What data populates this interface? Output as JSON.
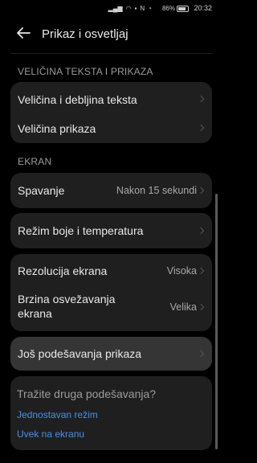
{
  "status_bar": {
    "battery_percent": "86%",
    "time": "20:32",
    "icons": [
      "signal-icon",
      "signal-icon",
      "wifi-icon",
      "notification-icon",
      "whatsapp-icon",
      "messenger-icon",
      "nfc-icon",
      "no-sound-icon",
      "alarm-icon"
    ]
  },
  "header": {
    "title": "Prikaz i osvetljaj"
  },
  "sections": {
    "text_display": {
      "label": "VELIČINA TEKSTA I PRIKAZA",
      "items": [
        {
          "label": "Veličina i debljina teksta"
        },
        {
          "label": "Veličina prikaza"
        }
      ]
    },
    "screen": {
      "label": "EKRAN",
      "sleep": {
        "label": "Spavanje",
        "value": "Nakon 15 sekundi"
      },
      "color": {
        "label": "Režim boje i temperatura"
      },
      "resolution": {
        "label": "Rezolucija ekrana",
        "value": "Visoka"
      },
      "refresh": {
        "label_line1": "Brzina osvežavanja",
        "label_line2": "ekrana",
        "value": "Velika"
      },
      "more": {
        "label": "Još podešavanja prikaza"
      }
    }
  },
  "suggestions": {
    "hint": "Tražite druga podešavanja?",
    "links": [
      "Jednostavan režim",
      "Uvek na ekranu"
    ]
  }
}
